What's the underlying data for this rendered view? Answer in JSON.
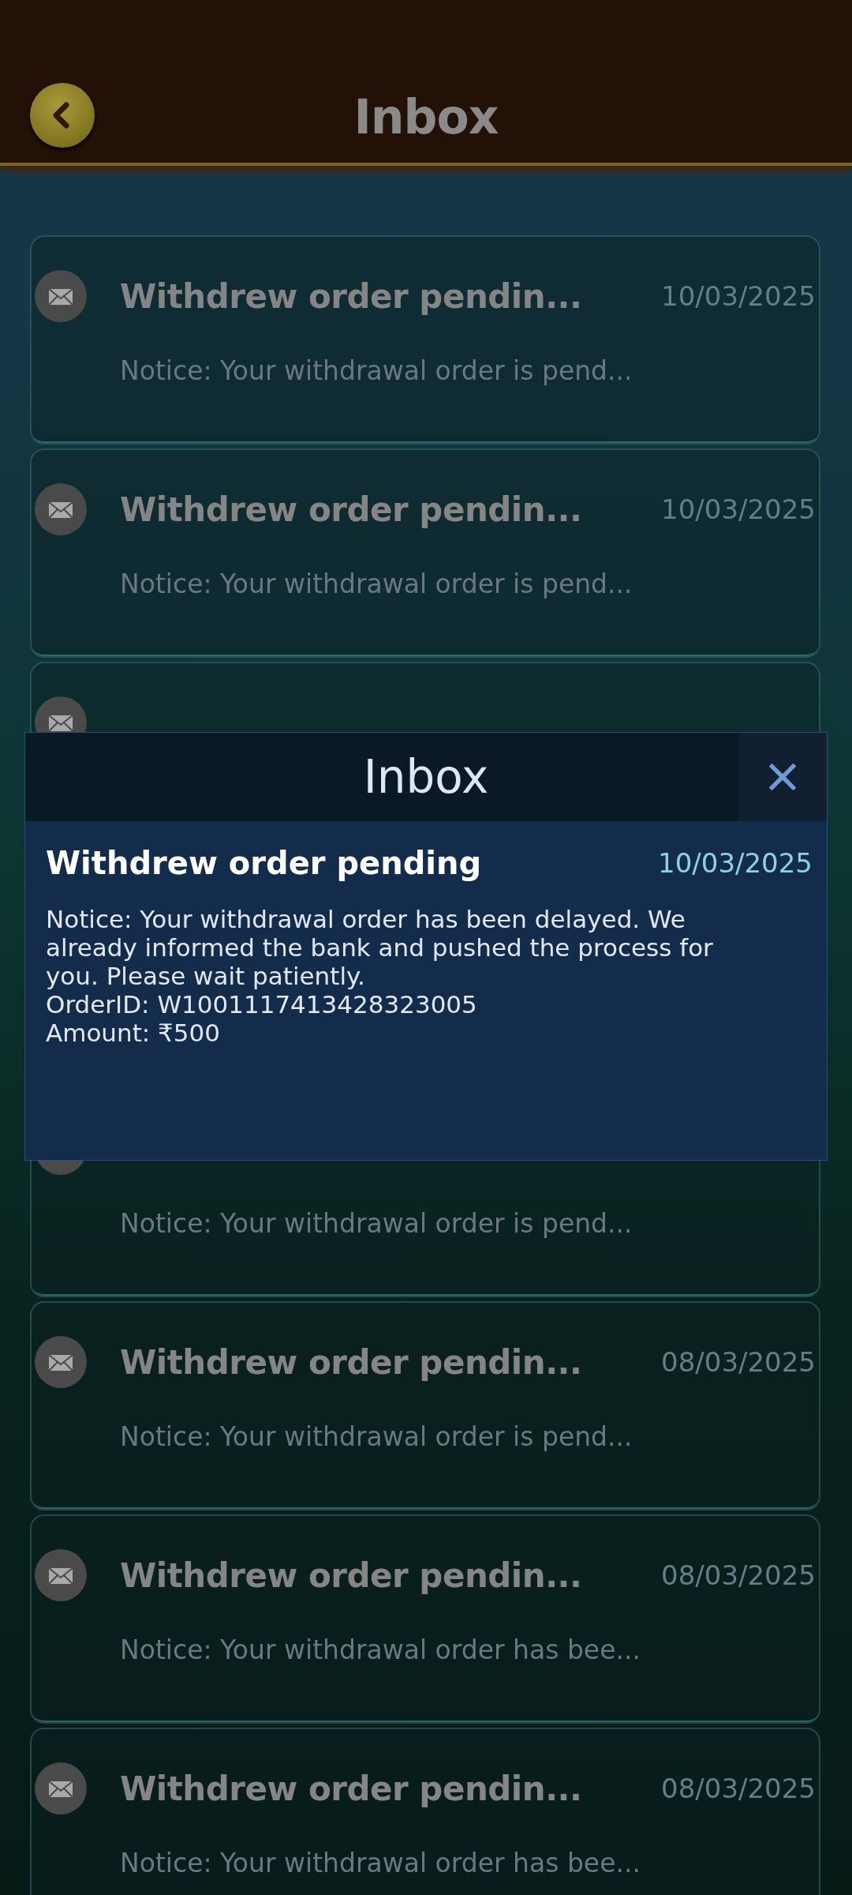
{
  "header": {
    "title": "Inbox"
  },
  "messages": [
    {
      "kind": "message",
      "title": "Withdrew order pendin...",
      "date": "10/03/2025",
      "preview": "Notice: Your withdrawal order is pend..."
    },
    {
      "kind": "message",
      "title": "Withdrew order pendin...",
      "date": "10/03/2025",
      "preview": "Notice: Your withdrawal order is pend..."
    },
    {
      "kind": "message"
    },
    {
      "kind": "message",
      "preview": "Notice: Your withdrawal order is pend..."
    },
    {
      "kind": "message",
      "title": "Withdrew order pendin...",
      "date": "08/03/2025",
      "preview": "Notice: Your withdrawal order is pend..."
    },
    {
      "kind": "message",
      "title": "Withdrew order pendin...",
      "date": "08/03/2025",
      "preview": "Notice: Your withdrawal order has bee..."
    },
    {
      "kind": "message",
      "title": "Withdrew order pendin...",
      "date": "08/03/2025",
      "preview": "Notice: Your withdrawal order has bee..."
    }
  ],
  "dialog": {
    "title": "Inbox",
    "message_title": "Withdrew order pending",
    "date": "10/03/2025",
    "body": [
      "Notice: Your withdrawal order has been delayed. We already informed the bank and pushed the process for you. Please wait patiently.",
      "OrderID: W1001117413428323005",
      "Amount: ₹500"
    ]
  }
}
